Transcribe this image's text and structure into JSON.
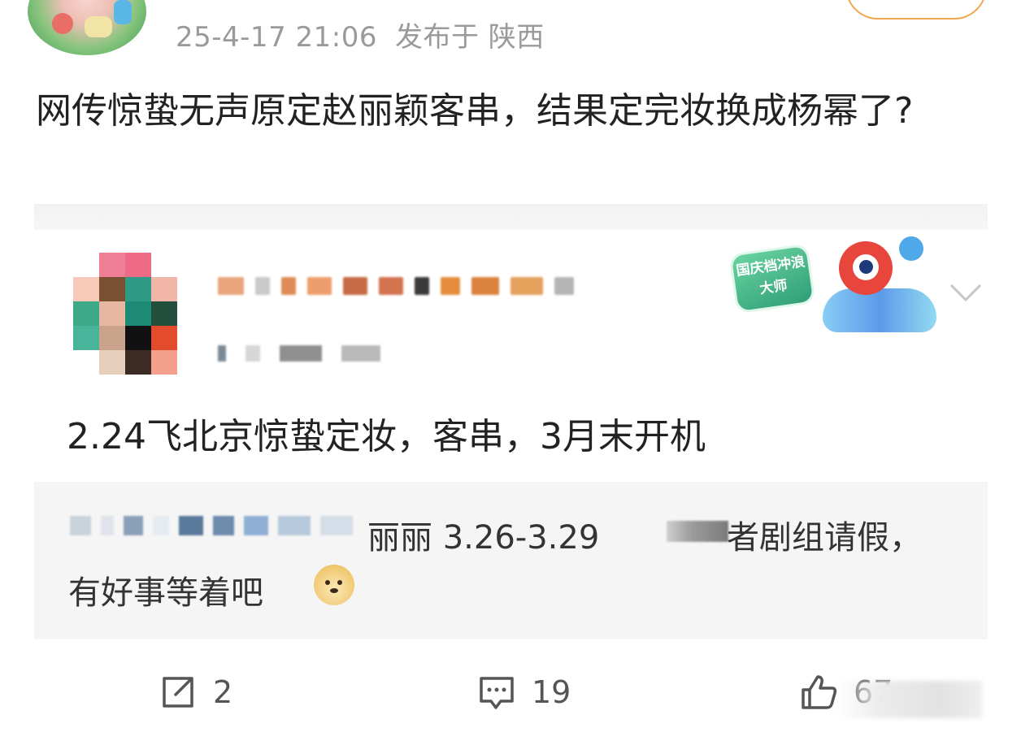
{
  "post": {
    "date": "25-4-17 21:06",
    "location": "发布于 陕西",
    "text": "网传惊蛰无声原定赵丽颖客串，结果定完妆换成杨幂了?"
  },
  "embedded": {
    "badge_text": "国庆档冲浪大师",
    "reply": "2.24飞北京惊蛰定妆，客串，3月末开机",
    "quote_line1_a": "丽丽 3.26-3.29",
    "quote_line1_b": "者剧组请假，",
    "quote_line2": "有好事等着吧"
  },
  "actions": {
    "repost_count": "2",
    "comment_count": "19",
    "like_count": "67"
  },
  "icons": {
    "repost": "repost-icon",
    "comment": "comment-icon",
    "like": "thumbs-up-icon",
    "chevron": "chevron-down-icon",
    "emoji": "doge-emoji-icon"
  },
  "colors": {
    "meta_text": "#9a9a9a",
    "follow_border": "#f2a54a",
    "quote_bg": "#f5f5f5"
  }
}
